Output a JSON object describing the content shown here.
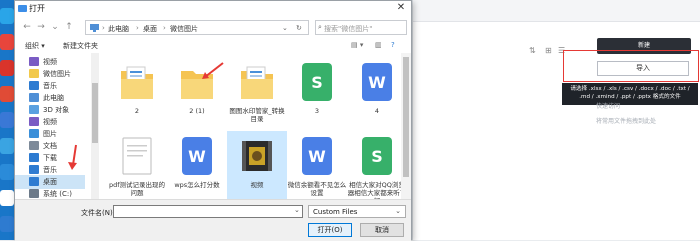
{
  "dialog": {
    "title": "打开",
    "close_glyph": "✕",
    "breadcrumb": [
      "此电脑",
      "桌面",
      "微信图片"
    ],
    "search_placeholder": "搜索\"微信图片\"",
    "toolbar": {
      "organize": "组织 ▾",
      "new_folder": "新建文件夹"
    },
    "sidebar": {
      "items": [
        {
          "label": "视频",
          "color": "#7a5cc4"
        },
        {
          "label": "微信图片",
          "color": "#f2c94c"
        },
        {
          "label": "音乐",
          "color": "#2d7bd1"
        },
        {
          "label": "此电脑",
          "color": "#4f8fd6"
        },
        {
          "label": "3D 对象",
          "color": "#5aa0e0"
        },
        {
          "label": "视频",
          "color": "#7a5cc4"
        },
        {
          "label": "图片",
          "color": "#3b8fd9"
        },
        {
          "label": "文档",
          "color": "#7d8a99"
        },
        {
          "label": "下载",
          "color": "#2d7bd1"
        },
        {
          "label": "音乐",
          "color": "#2d7bd1"
        },
        {
          "label": "桌面",
          "color": "#2d7bd1"
        },
        {
          "label": "系统 (C:)",
          "color": "#6c7a89"
        }
      ],
      "selected_index": 10
    },
    "files": [
      {
        "label": "2",
        "kind": "folder-docs"
      },
      {
        "label": "2 (1)",
        "kind": "folder"
      },
      {
        "label": "图图水印管家_转换目录",
        "kind": "folder-docs"
      },
      {
        "label": "3",
        "kind": "wps-sheet"
      },
      {
        "label": "4",
        "kind": "wps-word"
      },
      {
        "label": "pdf测试记录出现的问题",
        "kind": "blank-doc"
      },
      {
        "label": "wps怎么打分数",
        "kind": "wps-word"
      },
      {
        "label": "视频",
        "kind": "video"
      },
      {
        "label": "微信余额看不见怎么设置",
        "kind": "wps-word"
      },
      {
        "label": "相信大家对QQ浏览器相信大家都来听了解",
        "kind": "wps-sheet"
      }
    ],
    "filename_label": "文件名(N):",
    "filetype": "Custom Files",
    "open_button": "打开(O)",
    "cancel_button": "取消"
  },
  "webapp": {
    "new_button": "新建",
    "import_button": "导入",
    "tooltip": "请选择 .xlsx / .xls / .csv / .docx / .doc / .txt / .md / .xmind / .ppt / .pptx 格式的文件",
    "hint1": "快速访问",
    "hint2": "将常用文件拖拽到此处"
  },
  "colors": {
    "accent": "#0078d7",
    "red_annotation": "#e53935",
    "folder": "#f5c453",
    "wps_word": "#4a7fe6",
    "wps_sheet": "#37b06a"
  }
}
